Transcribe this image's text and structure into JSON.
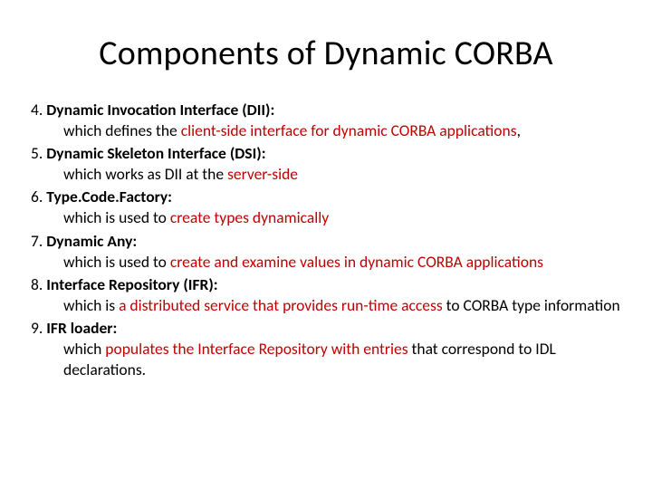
{
  "title": "Components of Dynamic CORBA",
  "items": [
    {
      "num": "4. ",
      "term": "Dynamic Invocation Interface (DII):",
      "pre": "which defines the ",
      "hl": "client-side interface for dynamic CORBA applications",
      "post": ","
    },
    {
      "num": "5. ",
      "term": "Dynamic Skeleton Interface (DSI):",
      "pre": "which works as DII at the ",
      "hl": "server-side",
      "post": ""
    },
    {
      "num": "6. ",
      "term": "Type.Code.Factory:",
      "pre": "which is used to ",
      "hl": "create types dynamically",
      "post": ""
    },
    {
      "num": "7. ",
      "term": "Dynamic Any:",
      "pre": "which is used to ",
      "hl": "create and examine values in dynamic CORBA applications",
      "post": ""
    },
    {
      "num": "8. ",
      "term": "Interface Repository (IFR):",
      "pre": "which is ",
      "hl": "a distributed service that provides run-time access",
      "post": " to CORBA type information"
    },
    {
      "num": "9. ",
      "term": "IFR loader:",
      "pre": "which ",
      "hl": "populates the Interface Repository with entries",
      "post": " that correspond to IDL declarations."
    }
  ]
}
